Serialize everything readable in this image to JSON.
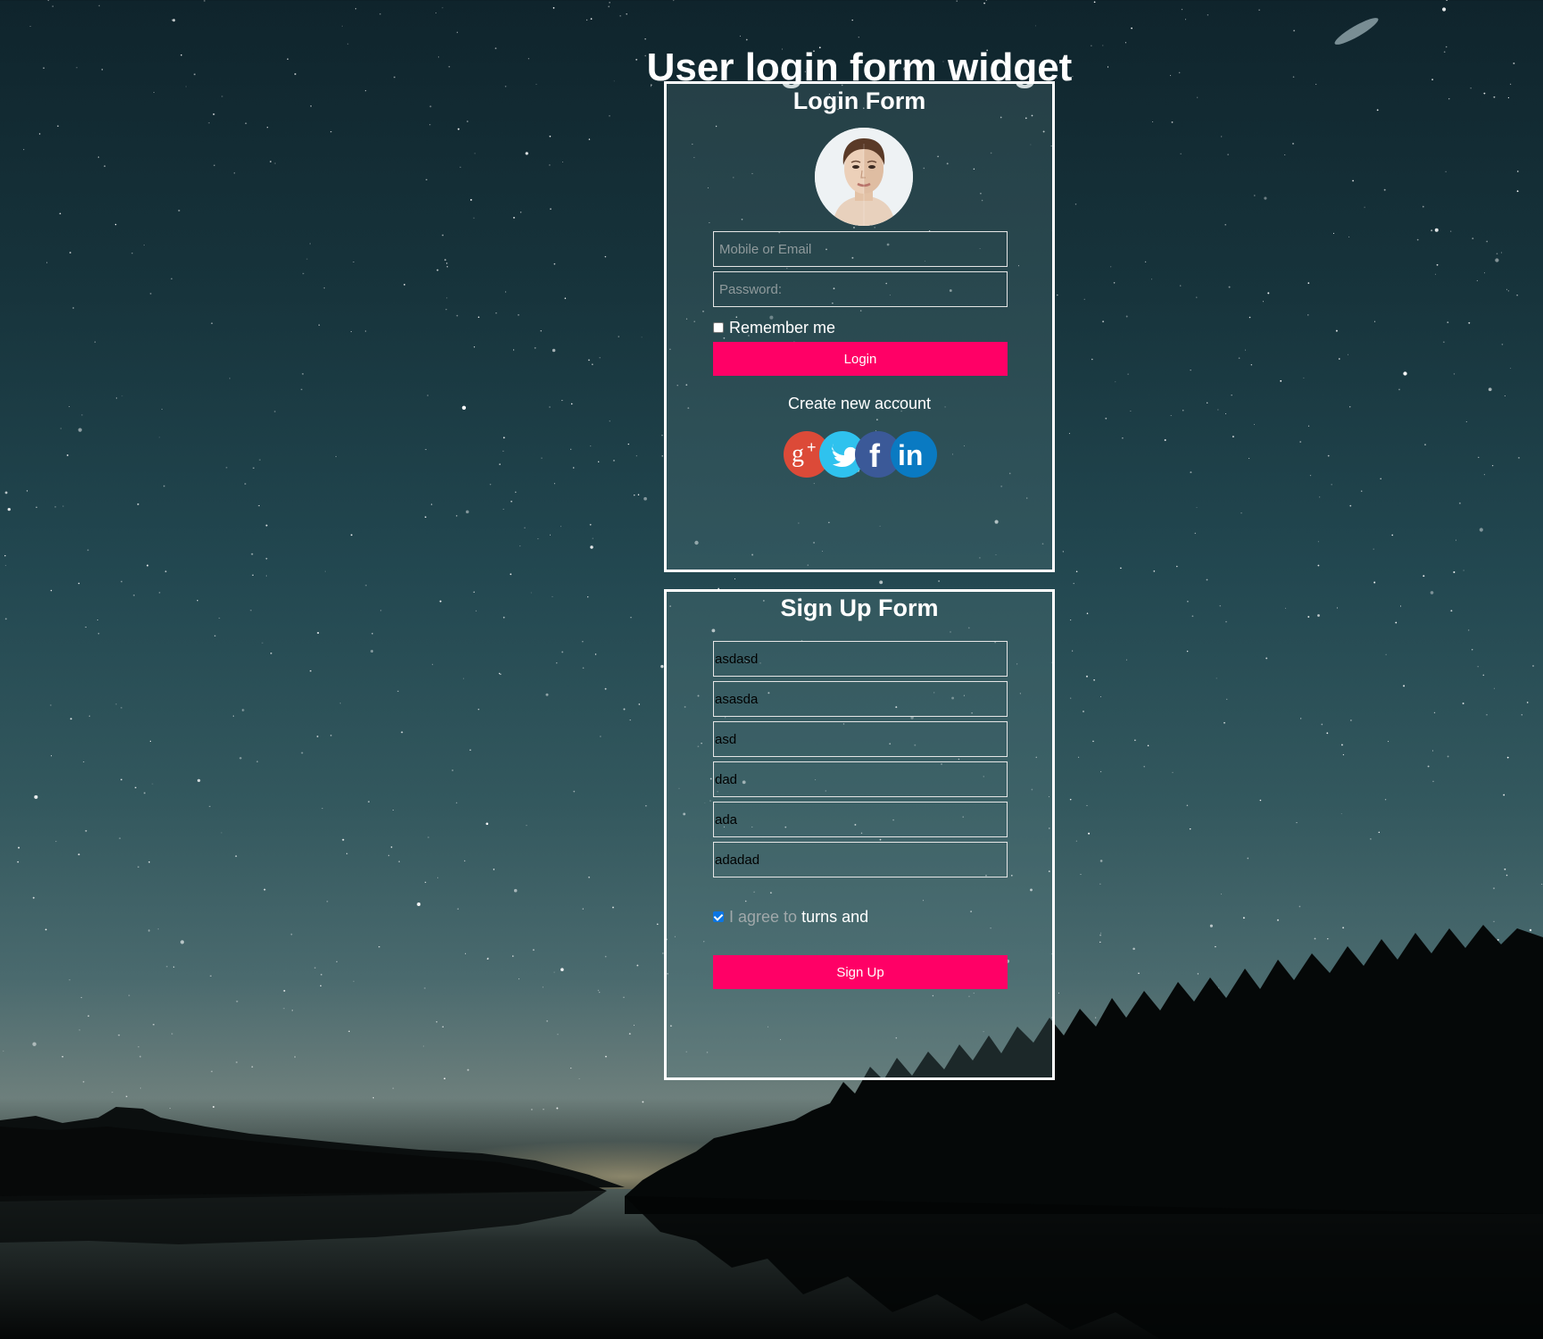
{
  "page": {
    "title": "User login form widget"
  },
  "login": {
    "title": "Login Form",
    "email_placeholder": "Mobile or Email",
    "password_placeholder": "Password:",
    "remember_label": "Remember me",
    "remember_checked": false,
    "login_button": "Login",
    "create_account": "Create new account",
    "social": [
      {
        "name": "google-plus",
        "icon": "google-plus-icon",
        "glyph": "g+",
        "color": "#dc4a38"
      },
      {
        "name": "twitter",
        "icon": "twitter-icon",
        "glyph": "",
        "color": "#2fc2ee"
      },
      {
        "name": "facebook",
        "icon": "facebook-icon",
        "glyph": "f",
        "color": "#3b5998"
      },
      {
        "name": "linkedin",
        "icon": "linkedin-icon",
        "glyph": "in",
        "color": "#0a7ac2"
      }
    ]
  },
  "signup": {
    "title": "Sign Up Form",
    "fields": [
      "asdasd",
      "asasda",
      "asd",
      "dad",
      "ada",
      "adadad"
    ],
    "agree_muted": "I agree to",
    "agree_strong": "turns and",
    "agree_checked": true,
    "signup_button": "Sign Up"
  },
  "colors": {
    "accent": "#ff0066",
    "panel_border": "#ffffff",
    "checkbox_blue": "#0b75e3"
  }
}
